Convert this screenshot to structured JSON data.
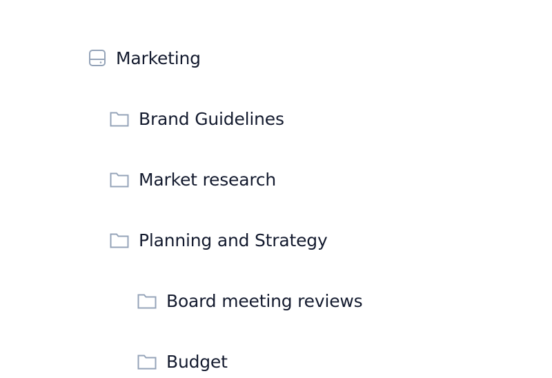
{
  "tree": {
    "root": {
      "label": "Marketing",
      "icon": "drive-icon"
    },
    "items": [
      {
        "label": "Brand Guidelines",
        "icon": "folder-icon",
        "level": 1
      },
      {
        "label": "Market research",
        "icon": "folder-icon",
        "level": 1
      },
      {
        "label": "Planning and Strategy",
        "icon": "folder-icon",
        "level": 1
      },
      {
        "label": "Board meeting reviews",
        "icon": "folder-icon",
        "level": 2
      },
      {
        "label": "Budget",
        "icon": "folder-icon",
        "level": 2
      }
    ]
  },
  "colors": {
    "icon": "#94a3b8",
    "text": "#131a2e"
  }
}
